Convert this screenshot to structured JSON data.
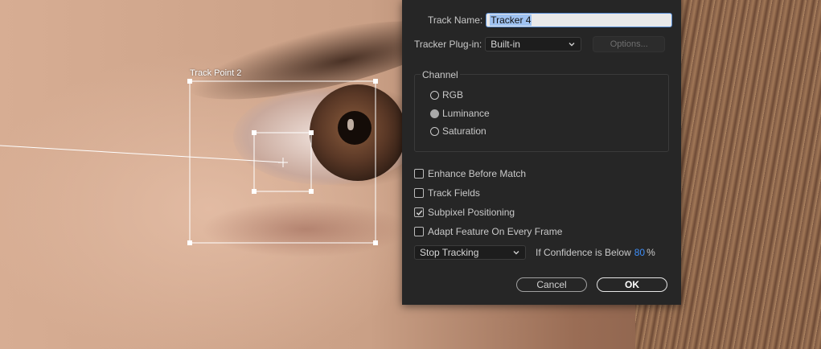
{
  "overlay": {
    "track_point_label": "Track Point 2"
  },
  "dialog": {
    "track_name_label": "Track Name:",
    "track_name_value": "Tracker 4",
    "plugin_label": "Tracker Plug-in:",
    "plugin_value": "Built-in",
    "options_label": "Options...",
    "channel": {
      "title": "Channel",
      "options": [
        {
          "label": "RGB",
          "selected": false
        },
        {
          "label": "Luminance",
          "selected": true
        },
        {
          "label": "Saturation",
          "selected": false
        }
      ]
    },
    "checkboxes": [
      {
        "label": "Enhance Before Match",
        "checked": false
      },
      {
        "label": "Track Fields",
        "checked": false
      },
      {
        "label": "Subpixel Positioning",
        "checked": true
      },
      {
        "label": "Adapt Feature On Every Frame",
        "checked": false
      }
    ],
    "action_dropdown_value": "Stop Tracking",
    "confidence_label": "If Confidence is Below",
    "confidence_value": "80",
    "percent_sign": "%",
    "cancel_label": "Cancel",
    "ok_label": "OK"
  },
  "colors": {
    "dialog_bg": "#262626",
    "accent_blue": "#3e8ef7",
    "input_focus": "#5a8fd6"
  }
}
